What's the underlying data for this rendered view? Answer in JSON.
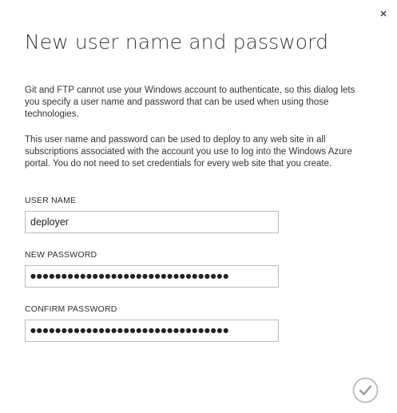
{
  "dialog": {
    "title": "New user name and password",
    "paragraph_1": "Git and FTP cannot use your Windows account to authenticate, so this dialog lets you specify a user name and password that can be used when using those technologies.",
    "paragraph_2": "This user name and password can be used to deploy to any web site in all subscriptions associated with the account you use to log into the Windows Azure portal. You do not need to set credentials for every web site that you create."
  },
  "form": {
    "username": {
      "label": "USER NAME",
      "value": "deployer"
    },
    "password": {
      "label": "NEW PASSWORD",
      "masked_value": "●●●●●●●●●●●●●●●●●●●●●●●●●●●●●●●●"
    },
    "confirm_password": {
      "label": "CONFIRM PASSWORD",
      "masked_value": "●●●●●●●●●●●●●●●●●●●●●●●●●●●●●●●●"
    }
  },
  "icons": {
    "close": "close-icon",
    "confirm": "checkmark-icon"
  },
  "colors": {
    "field_border": "#bcbcbc",
    "confirm_ring": "#c2c2c2",
    "text": "#333333"
  }
}
